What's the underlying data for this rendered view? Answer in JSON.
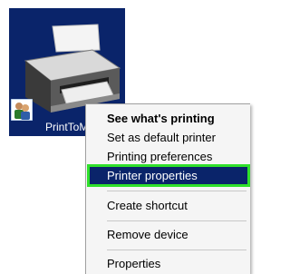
{
  "desktop_icon": {
    "caption": "PrintToM"
  },
  "context_menu": {
    "items": [
      {
        "label": "See what's printing"
      },
      {
        "label": "Set as default printer"
      },
      {
        "label": "Printing preferences"
      },
      {
        "label": "Printer properties"
      },
      {
        "label": "Create shortcut"
      },
      {
        "label": "Remove device"
      },
      {
        "label": "Properties"
      }
    ],
    "default_item": "See what's printing",
    "selected_item": "Printer properties"
  },
  "colors": {
    "selection_background": "#0a246a",
    "highlight_outline": "#2fe02b"
  }
}
